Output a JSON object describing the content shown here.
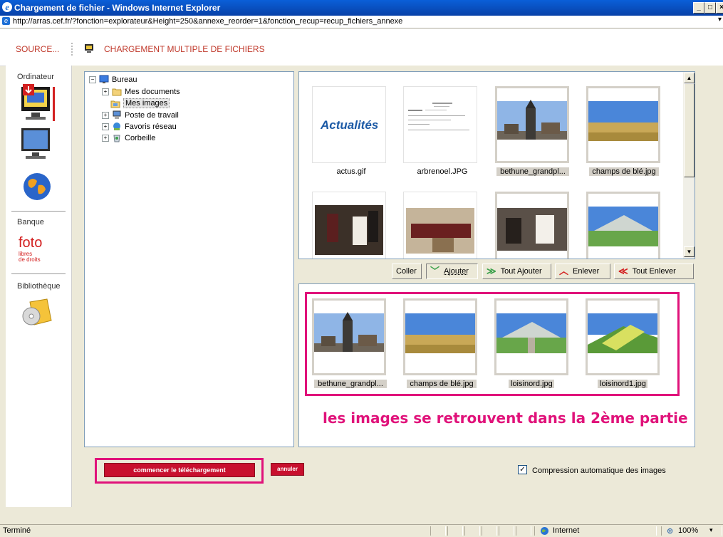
{
  "window": {
    "title": "Chargement de fichier - Windows Internet Explorer",
    "url": "http://arras.cef.fr/?fonction=explorateur&Height=250&annexe_reorder=1&fonction_recup=recup_fichiers_annexe"
  },
  "header": {
    "source_label": "SOURCE...",
    "page_title": "CHARGEMENT MULTIPLE DE FICHIERS"
  },
  "sidebar": {
    "ordinateur_label": "Ordinateur",
    "banque_label": "Banque",
    "foto_logo": "foto",
    "foto_sub1": "libres",
    "foto_sub2": "de droits",
    "bibliotheque_label": "Bibliothèque"
  },
  "tree": {
    "root": "Bureau",
    "items": [
      {
        "label": "Mes documents"
      },
      {
        "label": "Mes images"
      },
      {
        "label": "Poste de travail"
      },
      {
        "label": "Favoris réseau"
      },
      {
        "label": "Corbeille"
      }
    ]
  },
  "gallery": {
    "items": [
      {
        "caption": "actus.gif",
        "logo_text": "Actualités",
        "selected": false
      },
      {
        "caption": "arbrenoel.JPG",
        "selected": false
      },
      {
        "caption": "bethune_grandpl...",
        "selected": true
      },
      {
        "caption": "champs de blé.jpg",
        "selected": true
      }
    ]
  },
  "toolbar": {
    "coller": "Coller",
    "ajouter": "Ajouter",
    "tout_ajouter": "Tout Ajouter",
    "enlever": "Enlever",
    "tout_enlever": "Tout Enlever"
  },
  "destination": {
    "items": [
      {
        "caption": "bethune_grandpl..."
      },
      {
        "caption": "champs de blé.jpg"
      },
      {
        "caption": "loisinord.jpg"
      },
      {
        "caption": "loisinord1.jpg"
      }
    ],
    "annotation": "les images se retrouvent dans la 2ème partie"
  },
  "actions": {
    "start_upload": "commencer le téléchargement",
    "cancel": "annuler",
    "compression_label": "Compression automatique des images",
    "compression_checked": true
  },
  "statusbar": {
    "status": "Terminé",
    "zone": "Internet",
    "zoom": "100%"
  },
  "colors": {
    "accent_red": "#c0392b",
    "highlight_pink": "#e0127a",
    "button_red": "#c8102e"
  }
}
